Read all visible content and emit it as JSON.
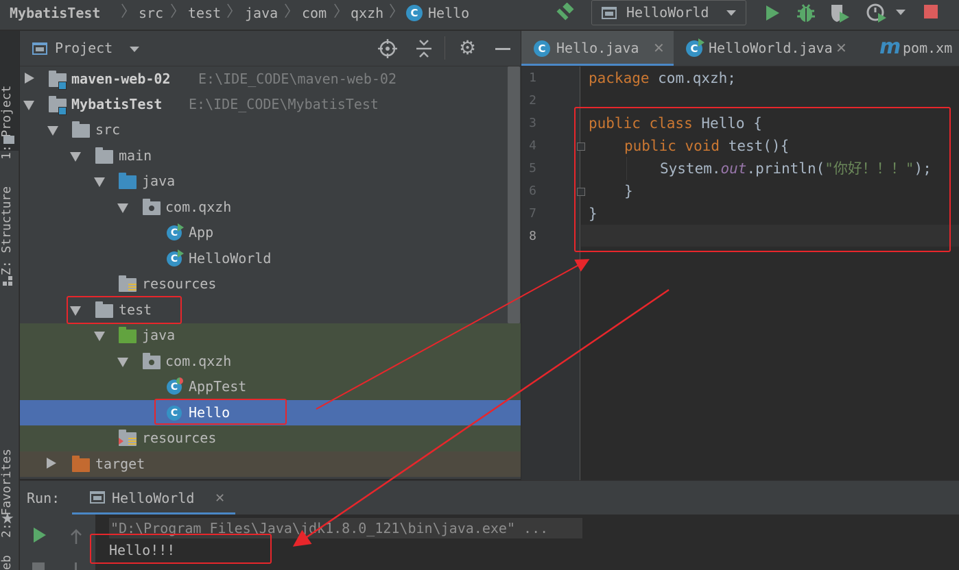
{
  "breadcrumb": {
    "items": [
      "MybatisTest",
      "src",
      "test",
      "java",
      "com",
      "qxzh",
      "Hello"
    ]
  },
  "toolbar": {
    "run_config": "HelloWorld"
  },
  "left_strip": {
    "project_tab": "1: Project",
    "structure_tab": "Z: Structure",
    "favorites_tab": "2: Favorites",
    "web_tab": "eb"
  },
  "project_panel": {
    "title": "Project",
    "tree": [
      {
        "label": "maven-web-02",
        "path": "E:\\IDE_CODE\\maven-web-02"
      },
      {
        "label": "MybatisTest",
        "path": "E:\\IDE_CODE\\MybatisTest"
      },
      {
        "label": "src"
      },
      {
        "label": "main"
      },
      {
        "label": "java"
      },
      {
        "label": "com.qxzh"
      },
      {
        "label": "App"
      },
      {
        "label": "HelloWorld"
      },
      {
        "label": "resources"
      },
      {
        "label": "test"
      },
      {
        "label": "java"
      },
      {
        "label": "com.qxzh"
      },
      {
        "label": "AppTest"
      },
      {
        "label": "Hello"
      },
      {
        "label": "resources"
      },
      {
        "label": "target"
      }
    ]
  },
  "editor": {
    "tabs": [
      {
        "label": "Hello.java",
        "icon": "C"
      },
      {
        "label": "HelloWorld.java",
        "icon": "C"
      },
      {
        "label": "pom.xm",
        "icon": "m"
      }
    ],
    "line_numbers": [
      "1",
      "2",
      "3",
      "4",
      "5",
      "6",
      "7",
      "8"
    ],
    "code": {
      "l1_kw": "package",
      "l1_rest": " com.qxzh;",
      "l3_kw": "public class",
      "l3_name": " Hello ",
      "l3_brace": "{",
      "l4_kw": "public void",
      "l4_rest": " test(){",
      "l5_a": "System.",
      "l5_field": "out",
      "l5_b": ".println(",
      "l5_str": "\"你好！！！\"",
      "l5_c": ");",
      "l6": "}",
      "l7": "}"
    }
  },
  "run_panel": {
    "label": "Run:",
    "tab": "HelloWorld",
    "command": "\"D:\\Program Files\\Java\\jdk1.8.0_121\\bin\\java.exe\" ...",
    "output": "Hello!!!"
  },
  "colors": {
    "annotation_red": "#e8262b",
    "selection_blue": "#4b6eaf",
    "test_bg_green": "#45503f",
    "excluded_bg": "#4e4a40"
  }
}
